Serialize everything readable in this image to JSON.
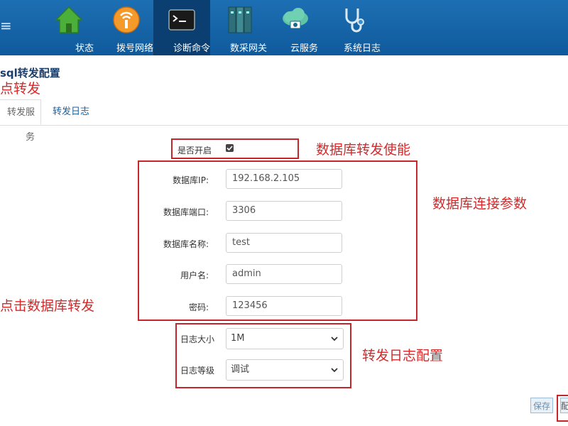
{
  "nav": {
    "items": [
      {
        "label": "状态",
        "icon": "home-icon"
      },
      {
        "label": "拨号网络",
        "icon": "dialup-network-icon"
      },
      {
        "label": "诊断命令",
        "icon": "terminal-icon",
        "active": true
      },
      {
        "label": "数采网关",
        "icon": "gateway-icon"
      },
      {
        "label": "云服务",
        "icon": "cloud-icon"
      },
      {
        "label": "系统日志",
        "icon": "stethoscope-icon"
      }
    ]
  },
  "page": {
    "title": "sql转发配置",
    "red_title": "点转发"
  },
  "tabs": [
    {
      "label": "转发服务"
    },
    {
      "label": "转发日志"
    }
  ],
  "form": {
    "enable_label": "是否开启",
    "enable_checked": true,
    "db_ip_label": "数据库IP:",
    "db_ip_value": "192.168.2.105",
    "db_port_label": "数据库端口:",
    "db_port_value": "3306",
    "db_name_label": "数据库名称:",
    "db_name_value": "test",
    "user_label": "用户名:",
    "user_value": "admin",
    "password_label": "密码:",
    "password_value": "123456",
    "log_size_label": "日志大小",
    "log_size_value": "1M",
    "log_level_label": "日志等级",
    "log_level_value": "调试"
  },
  "annotations": {
    "enable": "数据库转发使能",
    "connection": "数据库连接参数",
    "click": "点击数据库转发",
    "log": "转发日志配置"
  },
  "buttons": {
    "save": "保存",
    "config": "配"
  },
  "colors": {
    "nav_bg": "#1565a8",
    "nav_active": "#0b3f72",
    "annotation_red": "#d8282a"
  }
}
